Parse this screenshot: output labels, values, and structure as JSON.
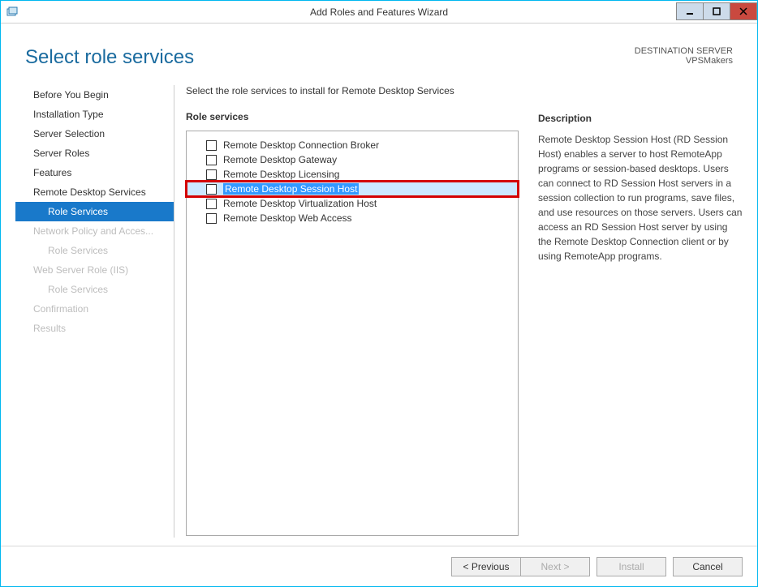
{
  "titlebar": {
    "title": "Add Roles and Features Wizard"
  },
  "header": {
    "page_title": "Select role services",
    "dest_label": "DESTINATION SERVER",
    "dest_server": "VPSMakers"
  },
  "sidebar": {
    "items": [
      {
        "label": "Before You Begin",
        "active": false,
        "disabled": false,
        "sub": false
      },
      {
        "label": "Installation Type",
        "active": false,
        "disabled": false,
        "sub": false
      },
      {
        "label": "Server Selection",
        "active": false,
        "disabled": false,
        "sub": false
      },
      {
        "label": "Server Roles",
        "active": false,
        "disabled": false,
        "sub": false
      },
      {
        "label": "Features",
        "active": false,
        "disabled": false,
        "sub": false
      },
      {
        "label": "Remote Desktop Services",
        "active": false,
        "disabled": false,
        "sub": false
      },
      {
        "label": "Role Services",
        "active": true,
        "disabled": false,
        "sub": true
      },
      {
        "label": "Network Policy and Acces...",
        "active": false,
        "disabled": true,
        "sub": false
      },
      {
        "label": "Role Services",
        "active": false,
        "disabled": true,
        "sub": true
      },
      {
        "label": "Web Server Role (IIS)",
        "active": false,
        "disabled": true,
        "sub": false
      },
      {
        "label": "Role Services",
        "active": false,
        "disabled": true,
        "sub": true
      },
      {
        "label": "Confirmation",
        "active": false,
        "disabled": true,
        "sub": false
      },
      {
        "label": "Results",
        "active": false,
        "disabled": true,
        "sub": false
      }
    ]
  },
  "main": {
    "instruction": "Select the role services to install for Remote Desktop Services",
    "roles_label": "Role services",
    "desc_label": "Description",
    "roles": [
      {
        "label": "Remote Desktop Connection Broker",
        "checked": false,
        "selected": false,
        "highlighted": false
      },
      {
        "label": "Remote Desktop Gateway",
        "checked": false,
        "selected": false,
        "highlighted": false
      },
      {
        "label": "Remote Desktop Licensing",
        "checked": false,
        "selected": false,
        "highlighted": false
      },
      {
        "label": "Remote Desktop Session Host",
        "checked": false,
        "selected": true,
        "highlighted": true
      },
      {
        "label": "Remote Desktop Virtualization Host",
        "checked": false,
        "selected": false,
        "highlighted": false
      },
      {
        "label": "Remote Desktop Web Access",
        "checked": false,
        "selected": false,
        "highlighted": false
      }
    ],
    "description": "Remote Desktop Session Host (RD Session Host) enables a server to host RemoteApp programs or session-based desktops. Users can connect to RD Session Host servers in a session collection to run programs, save files, and use resources on those servers. Users can access an RD Session Host server by using the Remote Desktop Connection client or by using RemoteApp programs."
  },
  "footer": {
    "previous": "< Previous",
    "next": "Next >",
    "install": "Install",
    "cancel": "Cancel"
  }
}
